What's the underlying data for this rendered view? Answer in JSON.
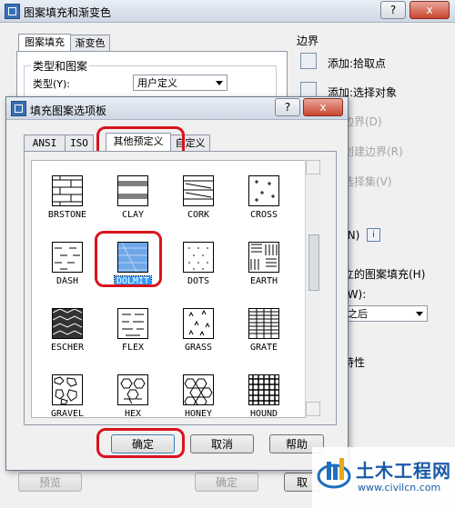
{
  "main_window": {
    "title": "图案填充和渐变色",
    "help_label": "?",
    "close_label": "x",
    "tabs": [
      {
        "label": "图案填充"
      },
      {
        "label": "渐变色"
      }
    ],
    "type_group": {
      "title": "类型和图案",
      "type_label": "类型(Y):",
      "type_value": "用户定义"
    },
    "right": {
      "boundary_title": "边界",
      "add_pick": "添加:拾取点",
      "add_select": "添加:选择对象",
      "remove_boundary": "边界(D)",
      "recreate_boundary": "创建边界(R)",
      "view_selection": "选择集(V)",
      "option_n": "(N)",
      "info_icon_label": "i",
      "independent_hatch": "立的图案填充(H)",
      "draw_order_label": "(W):",
      "draw_order_value": "之后",
      "inherit": "特性"
    },
    "bottom": {
      "preview": "预览",
      "ok": "确定",
      "cancel": "取"
    }
  },
  "dialog": {
    "title": "填充图案选项板",
    "help_label": "?",
    "close_label": "x",
    "tabs": [
      {
        "label": "ANSI"
      },
      {
        "label": "ISO"
      },
      {
        "label": "其他预定义"
      },
      {
        "label": "自定义"
      }
    ],
    "patterns": [
      {
        "name": "BRSTONE"
      },
      {
        "name": "CLAY"
      },
      {
        "name": "CORK"
      },
      {
        "name": "CROSS"
      },
      {
        "name": "DASH"
      },
      {
        "name": "DOLMIT"
      },
      {
        "name": "DOTS"
      },
      {
        "name": "EARTH"
      },
      {
        "name": "ESCHER"
      },
      {
        "name": "FLEX"
      },
      {
        "name": "GRASS"
      },
      {
        "name": "GRATE"
      },
      {
        "name": "GRAVEL"
      },
      {
        "name": "HEX"
      },
      {
        "name": "HONEY"
      },
      {
        "name": "HOUND"
      }
    ],
    "selected_pattern": "DOLMIT",
    "ok": "确定",
    "cancel": "取消",
    "help": "帮助"
  },
  "watermark": {
    "text": "土木工程网",
    "url": "www.civilcn.com"
  },
  "colors": {
    "highlight_ring": "#d9131d",
    "selection": "#3399ff"
  }
}
